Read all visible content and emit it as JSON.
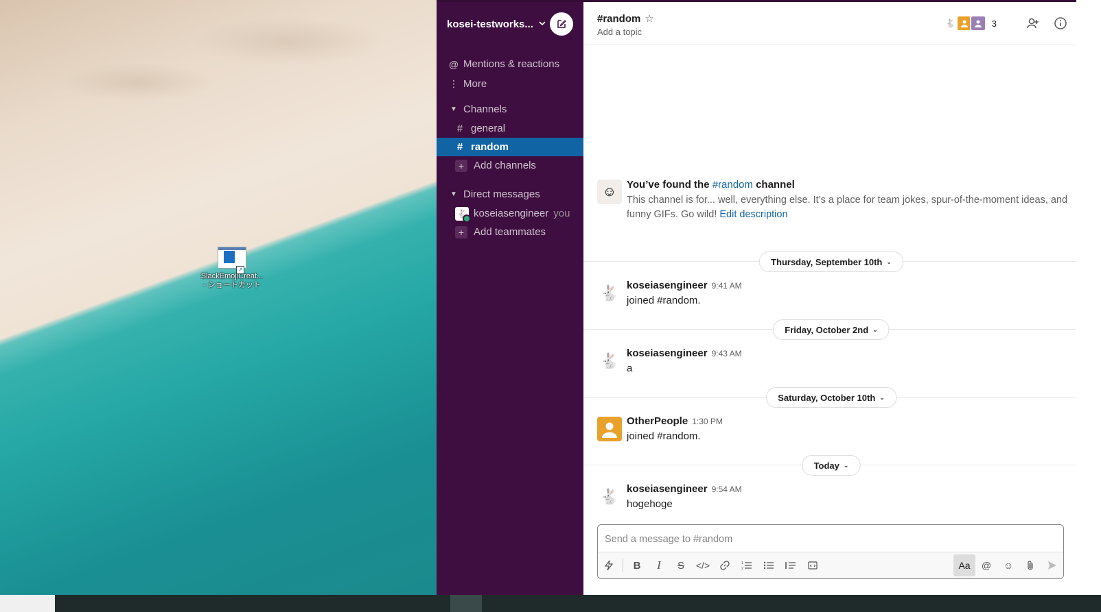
{
  "desktop": {
    "icon_label_1": "SlackEmojiCreat...",
    "icon_label_2": "- ショートカット"
  },
  "workspace": {
    "name": "kosei-testworks...",
    "chevron": "⌄"
  },
  "sidebar": {
    "mentions": "Mentions & reactions",
    "more": "More",
    "channels_header": "Channels",
    "channels": [
      {
        "name": "general"
      },
      {
        "name": "random"
      }
    ],
    "add_channels": "Add channels",
    "dm_header": "Direct messages",
    "dm_user": "koseiasengineer",
    "dm_you": "you",
    "add_teammates": "Add teammates"
  },
  "header": {
    "channel": "#random",
    "topic": "Add a topic",
    "member_count": "3"
  },
  "intro": {
    "prefix": "You’ve found the ",
    "channel_link": "#random",
    "suffix": " channel",
    "description": "This channel is for... well, everything else. It’s a place for team jokes, spur-of-the-moment ideas, and funny GIFs. Go wild! ",
    "edit_link": "Edit description"
  },
  "dates": [
    "Thursday, September 10th",
    "Friday, October 2nd",
    "Saturday, October 10th",
    "Today"
  ],
  "messages": [
    {
      "author": "koseiasengineer",
      "time": "9:41 AM",
      "text": "joined #random."
    },
    {
      "author": "koseiasengineer",
      "time": "9:43 AM",
      "text": "a"
    },
    {
      "author": "OtherPeople",
      "time": "1:30 PM",
      "text": "joined #random."
    },
    {
      "author": "koseiasengineer",
      "time": "9:54 AM",
      "text": "hogehoge"
    }
  ],
  "composer": {
    "placeholder": "Send a message to #random",
    "format_label": "Aa"
  },
  "colors": {
    "sidebar_bg": "#3f0e40",
    "selected": "#1164a3",
    "link": "#1264a3",
    "presence": "#2bac76"
  }
}
